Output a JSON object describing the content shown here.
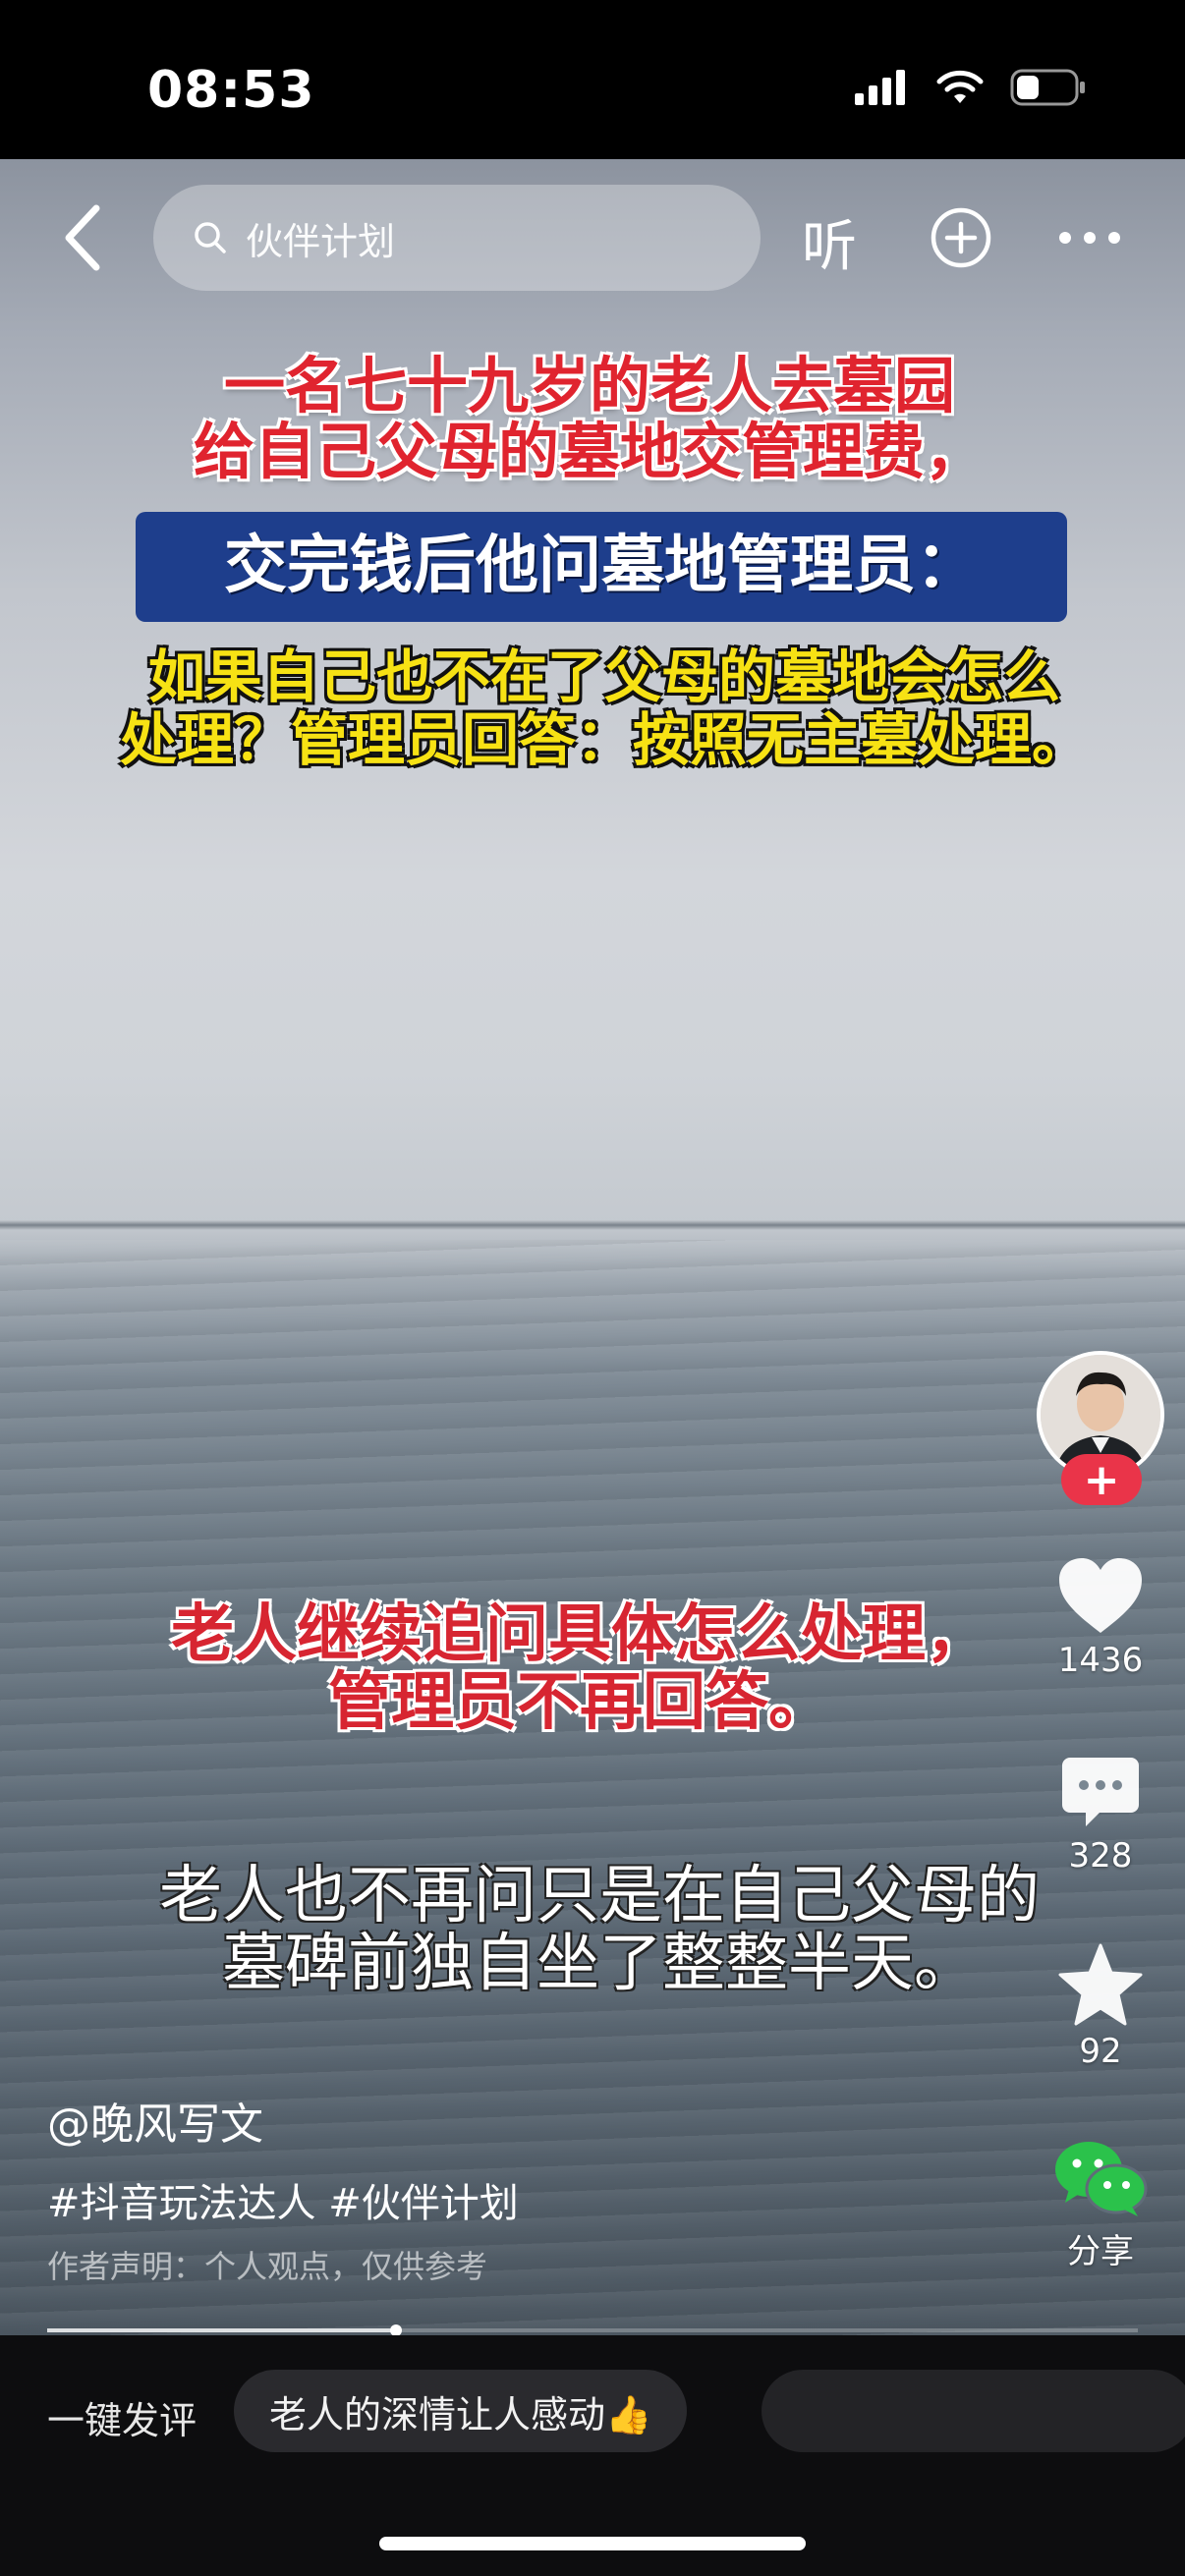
{
  "status_bar": {
    "time": "08:53"
  },
  "top_bar": {
    "search_placeholder": "伙伴计划",
    "listen_label": "听"
  },
  "captions": {
    "red_top_line1": "一名七十九岁的老人去墓园",
    "red_top_line2": "给自己父母的墓地交管理费，",
    "banner": "交完钱后他问墓地管理员：",
    "yellow_line1": "如果自己也不在了父母的墓地会怎么",
    "yellow_line2": "处理？管理员回答：按照无主墓处理。",
    "red_mid_line1": "老人继续追问具体怎么处理，",
    "red_mid_line2": "管理员不再回答。",
    "white_line1": "老人也不再问只是在自己父母的",
    "white_line2": "墓碑前独自坐了整整半天。"
  },
  "actions": {
    "follow_label": "+",
    "likes": "1436",
    "comments": "328",
    "favorites": "92",
    "share_label": "分享"
  },
  "post": {
    "author": "@晚风写文",
    "tags": "#抖音玩法达人 #伙伴计划",
    "disclaimer": "作者声明：个人观点，仅供参考",
    "progress": 0.32
  },
  "comment_bar": {
    "quick_label": "一键发评",
    "chips": [
      "老人的深情让人感动👍",
      ""
    ]
  },
  "colors": {
    "follow_red": "#ea3449",
    "banner_blue": "#1e3e8c",
    "caption_yellow": "#f7e214",
    "caption_red": "#e0242f",
    "share_green": "#2bc24b"
  }
}
